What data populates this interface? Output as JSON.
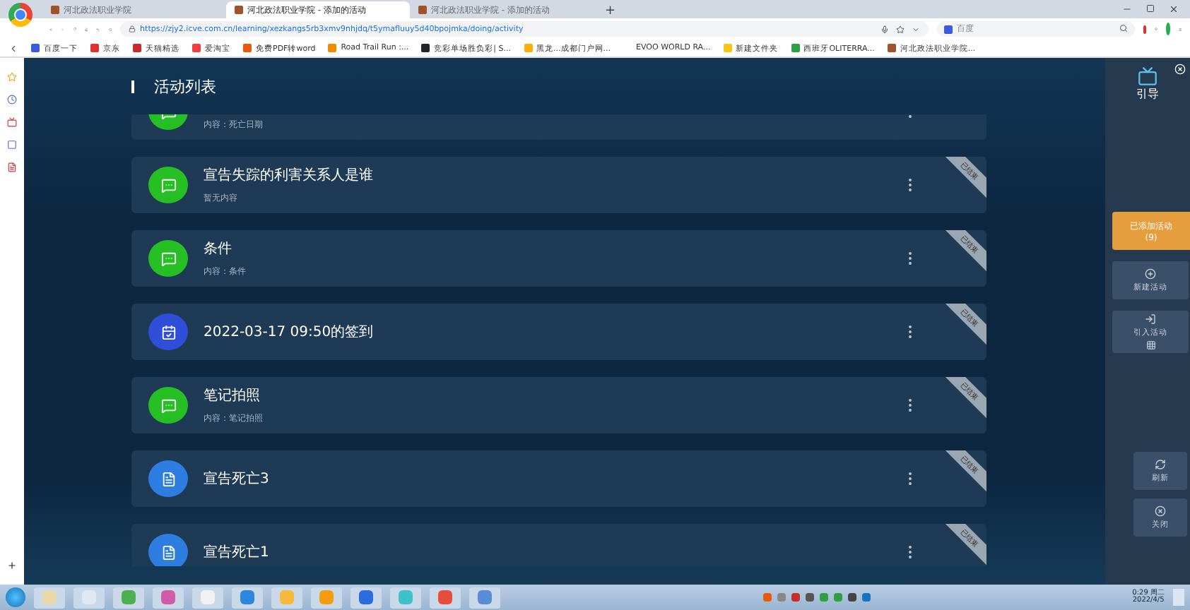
{
  "browser": {
    "tabs": [
      {
        "title": "河北政法职业学院",
        "selected": false
      },
      {
        "title": "河北政法职业学院 - 添加的活动",
        "selected": true
      },
      {
        "title": "河北政法职业学院 - 添加的活动",
        "selected": false
      }
    ],
    "new_tab": "+",
    "url": "https://zjy2.icve.com.cn/learning/xezkangs5rb3xmv9nhjdq/t5ymafluuy5d40bpojmka/doing/activity",
    "search": {
      "placeholder": "百度"
    },
    "bookmarks": [
      {
        "label": "百度一下",
        "color": "#3b5bdb"
      },
      {
        "label": "京东",
        "color": "#e03131"
      },
      {
        "label": "天猫精选",
        "color": "#c92a2a"
      },
      {
        "label": "爱淘宝",
        "color": "#f03e3e"
      },
      {
        "label": "免费PDF转word",
        "color": "#e8590c"
      },
      {
        "label": "Road Trail Run :...",
        "color": "#f08c00"
      },
      {
        "label": "竞彩单场胜负彩| S...",
        "color": "#212529"
      },
      {
        "label": "黑龙...成都门户网...",
        "color": "#fab005"
      },
      {
        "label": "EVOO WORLD RA...",
        "color": "#ffffff"
      },
      {
        "label": "新建文件夹",
        "color": "#fcc419"
      },
      {
        "label": "西班牙OLITERRA...",
        "color": "#2f9e44"
      },
      {
        "label": "河北政法职业学院...",
        "color": "#a0522d"
      }
    ]
  },
  "page": {
    "title": "活动列表",
    "activities": [
      {
        "kind": "discussion",
        "subtitle": "内容：死亡日期",
        "color": "#27c024"
      },
      {
        "kind": "discussion",
        "title": "宣告失踪的利害关系人是谁",
        "subtitle": "暂无内容",
        "badge": "已结束",
        "color": "#27c024"
      },
      {
        "kind": "discussion",
        "title": "条件",
        "subtitle": "内容：条件",
        "badge": "已结束",
        "color": "#27c024"
      },
      {
        "kind": "sign-in",
        "title": "2022-03-17 09:50的签到",
        "badge": "已结束",
        "color": "#2f4fd8"
      },
      {
        "kind": "discussion",
        "title": "笔记拍照",
        "subtitle": "内容：笔记拍照",
        "badge": "已结束",
        "color": "#27c024"
      },
      {
        "kind": "notes",
        "title": "宣告死亡3",
        "badge": "已结束",
        "color": "#2d7ee0"
      },
      {
        "kind": "notes",
        "title": "宣告死亡1",
        "badge": "已结束",
        "color": "#2d7ee0"
      }
    ],
    "side": {
      "guide": "引导",
      "added": "已添加活动",
      "added_count": "(9)",
      "new": "新建活动",
      "import": "引入活动",
      "refresh": "刷新",
      "close": "关闭"
    }
  },
  "taskbar": {
    "time": "0:29 周二",
    "date": "2022/4/5"
  }
}
